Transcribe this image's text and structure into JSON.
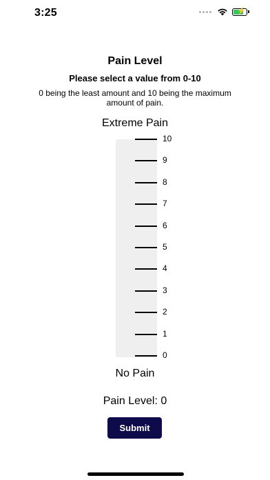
{
  "status_bar": {
    "time": "3:25",
    "icons": [
      "cellular-dots-icon",
      "wifi-icon",
      "battery-charging-icon"
    ],
    "battery_color": "#35c759"
  },
  "header": {
    "title": "Pain Level",
    "subtitle": "Please select a value from 0-10",
    "description": "0 being the least amount and 10 being the maximum amount of pain."
  },
  "scale": {
    "max_label": "Extreme Pain",
    "min_label": "No Pain",
    "ticks": [
      "10",
      "9",
      "8",
      "7",
      "6",
      "5",
      "4",
      "3",
      "2",
      "1",
      "0"
    ],
    "track_color": "#efefef"
  },
  "readout": {
    "label": "Pain Level:",
    "value": "0"
  },
  "submit": {
    "label": "Submit",
    "color": "#0d0b4a"
  }
}
